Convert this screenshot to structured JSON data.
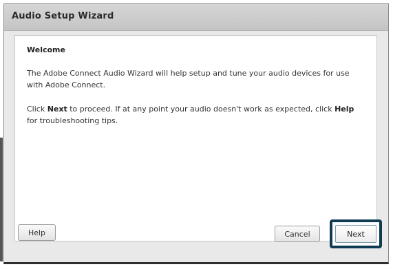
{
  "dialog": {
    "title": "Audio Setup Wizard",
    "heading": "Welcome",
    "paragraph1": "The Adobe Connect Audio Wizard will help setup and tune your audio devices for use with Adobe Connect.",
    "paragraph2_prefix": "Click ",
    "paragraph2_next": "Next",
    "paragraph2_middle": " to proceed. If at any point your audio doesn't work as expected, click ",
    "paragraph2_help": "Help",
    "paragraph2_suffix": " for troubleshooting tips.",
    "buttons": {
      "help": "Help",
      "cancel": "Cancel",
      "next": "Next"
    }
  },
  "colors": {
    "next_focus_border": "#0e3a52",
    "titlebar": "#cccccc"
  }
}
